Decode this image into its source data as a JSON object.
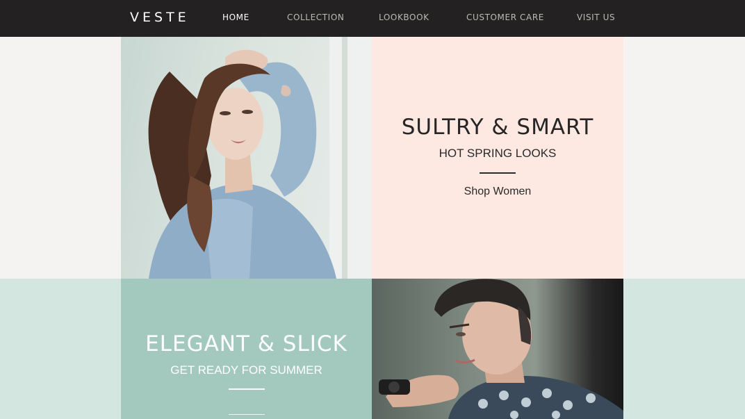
{
  "brand": {
    "logo": "VESTE"
  },
  "nav": {
    "items": [
      {
        "label": "HOME",
        "active": true
      },
      {
        "label": "COLLECTION",
        "active": false
      },
      {
        "label": "LOOKBOOK",
        "active": false
      },
      {
        "label": "CUSTOMER CARE",
        "active": false
      },
      {
        "label": "VISIT US",
        "active": false
      }
    ]
  },
  "promo_women": {
    "title": "SULTRY & SMART",
    "subtitle": "HOT SPRING LOOKS",
    "link": "Shop Women"
  },
  "promo_men": {
    "title": "ELEGANT & SLICK",
    "subtitle": "GET READY FOR SUMMER"
  },
  "colors": {
    "nav_bg": "#232121",
    "pink_panel": "#fde8e2",
    "mint_panel": "#a3c9be",
    "mint_band": "#d4e6e0"
  }
}
